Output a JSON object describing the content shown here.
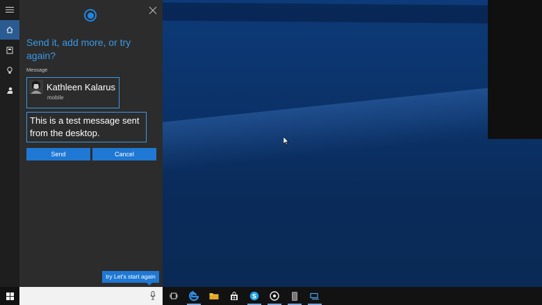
{
  "cortana": {
    "prompt": "Send it, add more, or try again?",
    "message_label": "Message",
    "contact": {
      "name": "Kathleen Kalarus",
      "type": "mobile"
    },
    "message_text": "This is a test message sent from the desktop.",
    "send_label": "Send",
    "cancel_label": "Cancel",
    "hint": "try Let's start again"
  },
  "rail": {
    "items": [
      {
        "icon": "menu-icon"
      },
      {
        "icon": "home-icon",
        "active": true
      },
      {
        "icon": "notebook-icon"
      },
      {
        "icon": "lightbulb-icon"
      },
      {
        "icon": "feedback-icon"
      }
    ]
  },
  "taskbar": {
    "icons": [
      "windows-icon",
      "task-view-icon",
      "edge-icon",
      "file-explorer-icon",
      "store-icon",
      "skype-icon",
      "groove-icon",
      "phone-icon",
      "tablet-icon"
    ]
  },
  "colors": {
    "accent": "#1e78d4",
    "panel": "#2c2c2c",
    "prompt": "#3a9ae9"
  }
}
